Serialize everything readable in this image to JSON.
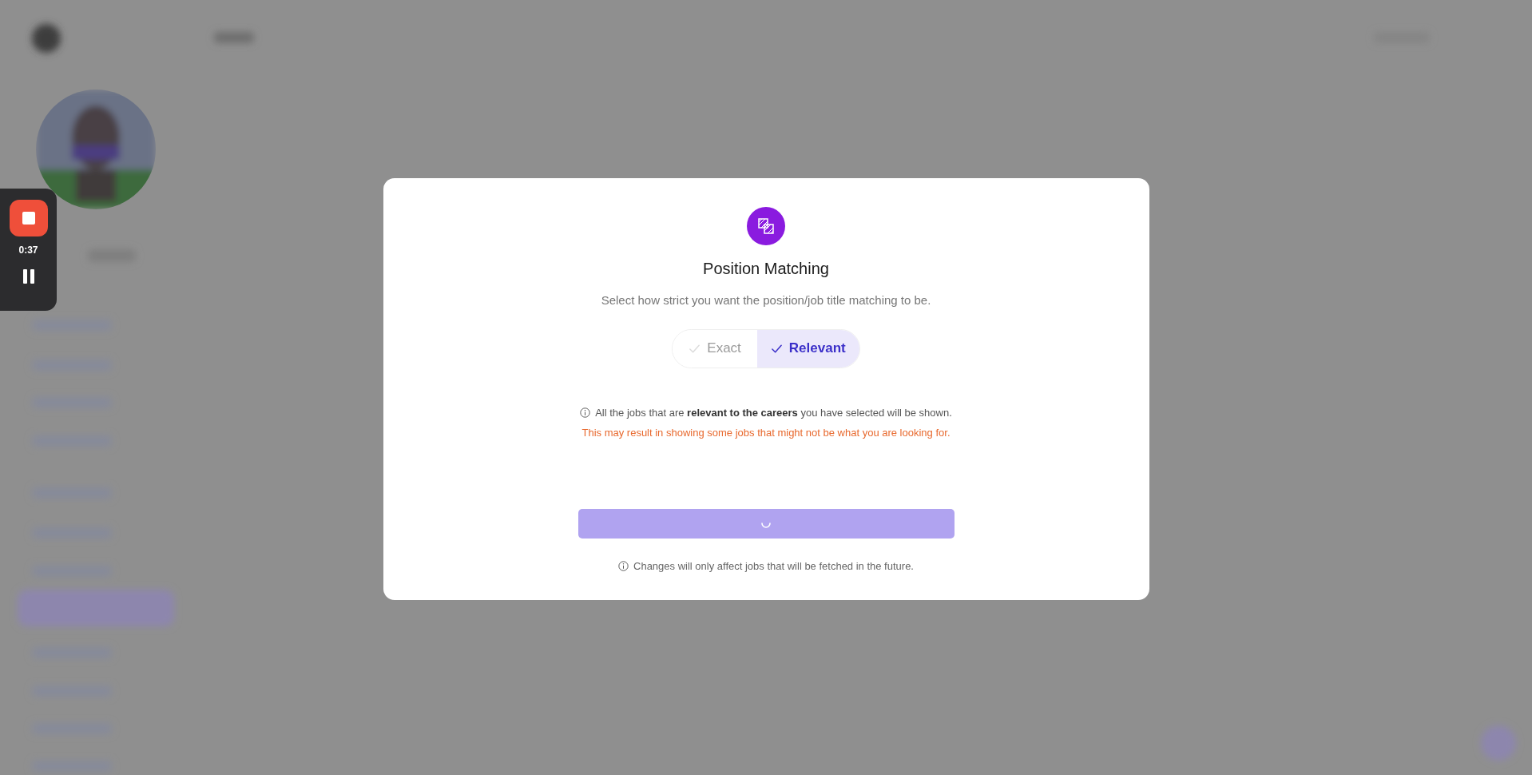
{
  "recorder": {
    "time": "0:37"
  },
  "dialog": {
    "title": "Position Matching",
    "subtitle": "Select how strict you want the position/job title matching to be.",
    "options": [
      {
        "label": "Exact",
        "selected": false
      },
      {
        "label": "Relevant",
        "selected": true
      }
    ],
    "info": "All the jobs that are **relevant to the careers** you have selected will be shown.",
    "warning": "This may result in showing some jobs that might not be what you are looking for.",
    "submit": {
      "loading": true
    },
    "note": "Changes will only affect jobs that will be fetched in the future."
  }
}
